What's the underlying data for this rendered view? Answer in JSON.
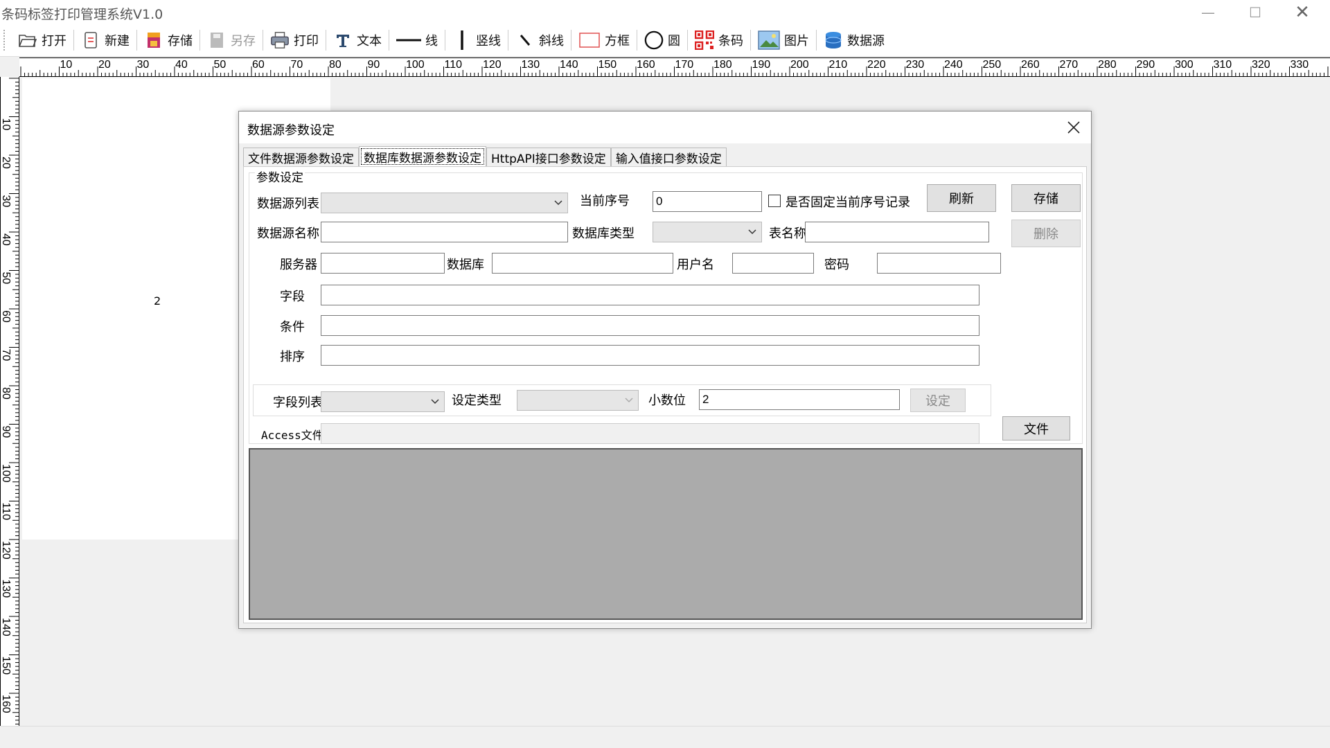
{
  "app": {
    "title": "条码标签打印管理系统V1.0",
    "window_controls": {
      "minimize": "—",
      "maximize": "☐",
      "close": "✕"
    }
  },
  "toolbar": {
    "items": [
      {
        "label": "打开",
        "icon": "folder-open-icon"
      },
      {
        "label": "新建",
        "icon": "new-document-icon"
      },
      {
        "label": "存储",
        "icon": "save-icon"
      },
      {
        "label": "另存",
        "icon": "save-as-icon",
        "disabled": true
      },
      {
        "label": "打印",
        "icon": "printer-icon"
      },
      {
        "label": "文本",
        "icon": "text-icon"
      },
      {
        "label": "线",
        "icon": "line-icon"
      },
      {
        "label": "竖线",
        "icon": "vertical-line-icon"
      },
      {
        "label": "斜线",
        "icon": "diagonal-line-icon"
      },
      {
        "label": "方框",
        "icon": "rectangle-icon"
      },
      {
        "label": "圆",
        "icon": "circle-icon"
      },
      {
        "label": "条码",
        "icon": "qr-code-icon"
      },
      {
        "label": "图片",
        "icon": "image-icon"
      },
      {
        "label": "数据源",
        "icon": "database-icon"
      }
    ]
  },
  "ruler": {
    "h_labels": [
      "10",
      "20",
      "30",
      "40",
      "50",
      "60",
      "70",
      "80",
      "90",
      "100",
      "110",
      "120",
      "130",
      "140",
      "150",
      "160",
      "170",
      "180",
      "190",
      "200",
      "210",
      "220",
      "230",
      "240",
      "250",
      "260",
      "270",
      "280",
      "290",
      "300",
      "310",
      "320",
      "330"
    ],
    "v_labels": [
      "10",
      "20",
      "30",
      "40",
      "50",
      "60",
      "70",
      "80",
      "90",
      "100",
      "110",
      "120",
      "130",
      "140",
      "150",
      "160"
    ]
  },
  "canvas": {
    "page_number": "2"
  },
  "dialog": {
    "title": "数据源参数设定",
    "tabs": [
      "文件数据源参数设定",
      "数据库数据源参数设定",
      "HttpAPI接口参数设定",
      "输入值接口参数设定"
    ],
    "active_tab": 1,
    "group_title": "参数设定",
    "labels": {
      "datasource_list": "数据源列表",
      "current_seq": "当前序号",
      "fix_seq": "是否固定当前序号记录",
      "datasource_name": "数据源名称",
      "db_type": "数据库类型",
      "table_name": "表名称",
      "server": "服务器",
      "database": "数据库",
      "username": "用户名",
      "password": "密码",
      "fields": "字段",
      "condition": "条件",
      "sort": "排序",
      "field_list": "字段列表",
      "set_type": "设定类型",
      "decimals": "小数位",
      "access_file": "Access文件"
    },
    "values": {
      "current_seq": "0",
      "decimals": "2"
    },
    "buttons": {
      "refresh": "刷新",
      "save": "存储",
      "delete": "删除",
      "set": "设定",
      "file": "文件"
    }
  }
}
